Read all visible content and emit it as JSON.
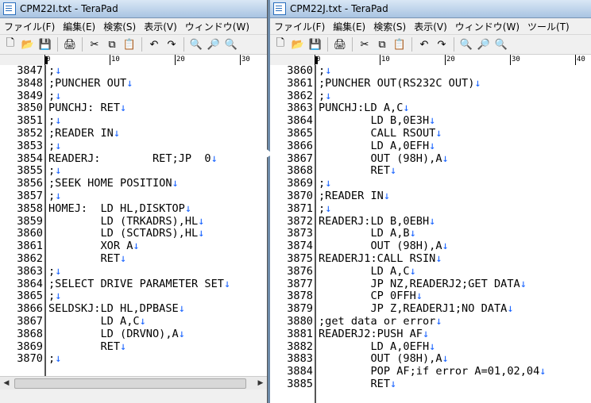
{
  "left": {
    "title": "CPM22I.txt - TeraPad",
    "menu": [
      "ファイル(F)",
      "編集(E)",
      "検索(S)",
      "表示(V)",
      "ウィンドウ(W)"
    ],
    "ruler": [
      "0",
      "10",
      "20",
      "30"
    ],
    "line_numbers": [
      "3847",
      "3848",
      "3849",
      "3850",
      "3851",
      "3852",
      "3853",
      "3854",
      "3855",
      "3856",
      "3857",
      "3858",
      "3859",
      "3860",
      "3861",
      "3862",
      "3863",
      "3864",
      "3865",
      "3866",
      "3867",
      "3868",
      "3869",
      "3870"
    ],
    "lines": [
      ";",
      ";PUNCHER OUT",
      ";",
      "PUNCHJ: RET",
      ";",
      ";READER IN",
      ";",
      "READERJ:        RET;JP  0",
      ";",
      ";SEEK HOME POSITION",
      ";",
      "HOMEJ:  LD HL,DISKTOP",
      "        LD (TRKADRS),HL",
      "        LD (SCTADRS),HL",
      "        XOR A",
      "        RET",
      ";",
      ";SELECT DRIVE PARAMETER SET",
      ";",
      "SELDSKJ:LD HL,DPBASE",
      "        LD A,C",
      "        LD (DRVNO),A",
      "        RET",
      ";"
    ]
  },
  "right": {
    "title": "CPM22J.txt - TeraPad",
    "menu": [
      "ファイル(F)",
      "編集(E)",
      "検索(S)",
      "表示(V)",
      "ウィンドウ(W)",
      "ツール(T)"
    ],
    "ruler": [
      "0",
      "10",
      "20",
      "30",
      "40"
    ],
    "line_numbers": [
      "3860",
      "3861",
      "3862",
      "3863",
      "3864",
      "3865",
      "3866",
      "3867",
      "3868",
      "3869",
      "3870",
      "3871",
      "3872",
      "3873",
      "3874",
      "3875",
      "3876",
      "3877",
      "3878",
      "3879",
      "3880",
      "3881",
      "3882",
      "3883",
      "3884",
      "3885"
    ],
    "lines": [
      ";",
      ";PUNCHER OUT(RS232C OUT)",
      ";",
      "PUNCHJ:LD A,C",
      "        LD B,0E3H",
      "        CALL RSOUT",
      "        LD A,0EFH",
      "        OUT (98H),A",
      "        RET",
      ";",
      ";READER IN",
      ";",
      "READERJ:LD B,0EBH",
      "        LD A,B",
      "        OUT (98H),A",
      "READERJ1:CALL RSIN",
      "        LD A,C",
      "        JP NZ,READERJ2;GET DATA",
      "        CP 0FFH",
      "        JP Z,READERJ1;NO DATA",
      ";get data or error",
      "READERJ2:PUSH AF",
      "        LD A,0EFH",
      "        OUT (98H),A",
      "        POP AF;if error A=01,02,04",
      "        RET"
    ]
  },
  "colors": {
    "newline_mark": "#1a64ff",
    "title_bg": "#a9c4e2"
  },
  "toolbar_icons": [
    "new-icon",
    "open-icon",
    "save-icon",
    "print-icon",
    "cut-icon",
    "copy-icon",
    "paste-icon",
    "undo-icon",
    "redo-icon",
    "find-icon",
    "find-next-icon",
    "find-prev-icon"
  ]
}
